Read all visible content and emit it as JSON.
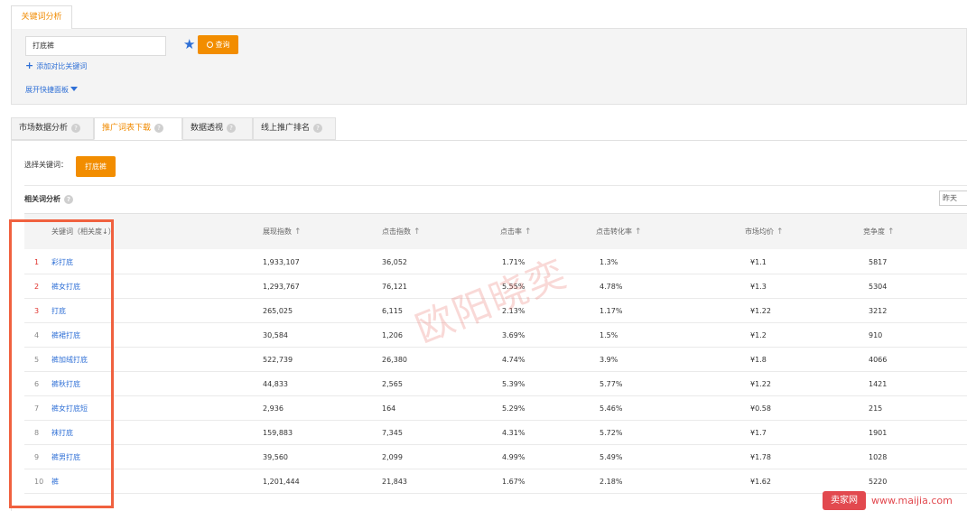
{
  "top_tab": {
    "label": "关键词分析"
  },
  "search": {
    "value": "打底裤",
    "query_label": "查询",
    "add_compare_label": "添加对比关键词",
    "expand_panel_label": "展开快捷面板"
  },
  "sub_tabs": [
    {
      "label": "市场数据分析"
    },
    {
      "label": "推广词表下载"
    },
    {
      "label": "数据透视"
    },
    {
      "label": "线上推广排名"
    }
  ],
  "selection": {
    "label": "选择关键词：",
    "keyword": "打底裤"
  },
  "section": {
    "title": "相关词分析",
    "date_option": "昨天"
  },
  "table": {
    "headers": [
      "关键词（相关度↓）",
      "展现指数",
      "点击指数",
      "点击率",
      "点击转化率",
      "市场均价",
      "竞争度"
    ],
    "rows": [
      [
        "1",
        "彩打底",
        "1,933,107",
        "36,052",
        "1.71%",
        "1.3%",
        "¥1.1",
        "5817"
      ],
      [
        "2",
        "裤女打底",
        "1,293,767",
        "76,121",
        "5.55%",
        "4.78%",
        "¥1.3",
        "5304"
      ],
      [
        "3",
        "打底",
        "265,025",
        "6,115",
        "2.13%",
        "1.17%",
        "¥1.22",
        "3212"
      ],
      [
        "4",
        "裤裙打底",
        "30,584",
        "1,206",
        "3.69%",
        "1.5%",
        "¥1.2",
        "910"
      ],
      [
        "5",
        "裤加绒打底",
        "522,739",
        "26,380",
        "4.74%",
        "3.9%",
        "¥1.8",
        "4066"
      ],
      [
        "6",
        "裤秋打底",
        "44,833",
        "2,565",
        "5.39%",
        "5.77%",
        "¥1.22",
        "1421"
      ],
      [
        "7",
        "裤女打底短",
        "2,936",
        "164",
        "5.29%",
        "5.46%",
        "¥0.58",
        "215"
      ],
      [
        "8",
        "袜打底",
        "159,883",
        "7,345",
        "4.31%",
        "5.72%",
        "¥1.7",
        "1901"
      ],
      [
        "9",
        "裤男打底",
        "39,560",
        "2,099",
        "4.99%",
        "5.49%",
        "¥1.78",
        "1028"
      ],
      [
        "10",
        "裤",
        "1,201,444",
        "21,843",
        "1.67%",
        "2.18%",
        "¥1.62",
        "5220"
      ]
    ]
  },
  "watermark": "欧阳晓奕",
  "brand": {
    "logo": "卖家网",
    "url": "www.maijia.com"
  },
  "colors": {
    "accent": "#f28d00",
    "link": "#2e6fd6",
    "highlight_box": "#f0613f",
    "top_rank": "#e0302a"
  }
}
